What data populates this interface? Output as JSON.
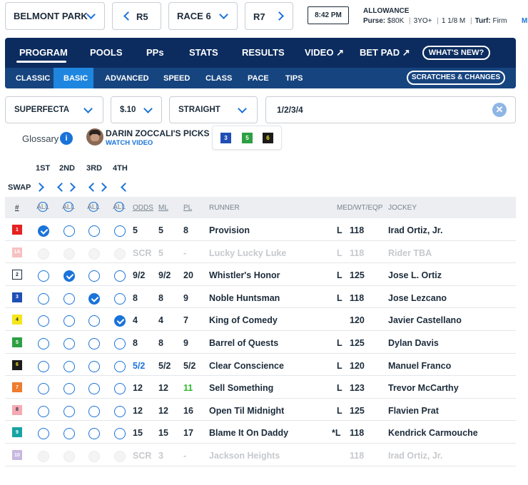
{
  "topbar": {
    "track": "BELMONT PARK",
    "prev_race": "R5",
    "race": "RACE 6",
    "next_race": "R7",
    "post_time": "8:42 PM",
    "race_type": "ALLOWANCE",
    "purse_label": "Purse:",
    "purse": "$80K",
    "age": "3YO+",
    "distance": "1 1/8 M",
    "surface_label": "Turf:",
    "surface": "Firm",
    "overflow": "M"
  },
  "nav": {
    "tabs": [
      "PROGRAM",
      "POOLS",
      "PPs",
      "STATS",
      "RESULTS",
      "VIDEO",
      "BET PAD"
    ],
    "whats_new": "WHAT'S NEW?",
    "subtabs": [
      "CLASSIC",
      "BASIC",
      "ADVANCED",
      "SPEED",
      "CLASS",
      "PACE",
      "TIPS"
    ],
    "scratches": "SCRATCHES & CHANGES"
  },
  "bet": {
    "type": "SUPERFECTA",
    "amount": "$.10",
    "mode": "STRAIGHT",
    "selection": "1/2/3/4"
  },
  "picks": {
    "glossary": "Glossary",
    "title": "DARIN ZOCCALI'S PICKS",
    "watch": "WATCH VIDEO",
    "numbers": [
      "3",
      "5",
      "6"
    ]
  },
  "positions": [
    "1ST",
    "2ND",
    "3RD",
    "4TH"
  ],
  "swap_label": "SWAP",
  "all_label": "ALL",
  "headers": {
    "num": "#",
    "odds": "ODDS",
    "ml": "ML",
    "pl": "PL",
    "runner": "RUNNER",
    "medwt": "MED/WT/EQP",
    "jockey": "JOCKEY"
  },
  "colors": {
    "nav_dark": "#0c2c5f",
    "nav_mid": "#16447f",
    "accent": "#1a73d9",
    "pl_green": "#2eb82e"
  },
  "runners": [
    {
      "pn": "1",
      "bg": "#e52121",
      "fg": "#ffffff",
      "odds": "5",
      "ml": "5",
      "pl": "8",
      "name": "Provision",
      "med": "L",
      "wt": "118",
      "jockey": "Irad Ortiz, Jr.",
      "scr": false,
      "sel": 0
    },
    {
      "pn": "1A",
      "bg": "#f7c1c1",
      "fg": "#ffffff",
      "odds": "SCR",
      "ml": "5",
      "pl": "-",
      "name": "Lucky Lucky Luke",
      "med": "L",
      "wt": "118",
      "jockey": "Rider TBA",
      "scr": true,
      "sel": -1
    },
    {
      "pn": "2",
      "bg": "#ffffff",
      "fg": "#1c2b3a",
      "odds": "9/2",
      "ml": "9/2",
      "pl": "20",
      "name": "Whistler's Honor",
      "med": "L",
      "wt": "125",
      "jockey": "Jose L. Ortiz",
      "scr": false,
      "sel": 1
    },
    {
      "pn": "3",
      "bg": "#1f4fb5",
      "fg": "#ffffff",
      "odds": "8",
      "ml": "8",
      "pl": "9",
      "name": "Noble Huntsman",
      "med": "L",
      "wt": "118",
      "jockey": "Jose Lezcano",
      "scr": false,
      "sel": 2
    },
    {
      "pn": "4",
      "bg": "#f5e61c",
      "fg": "#1c2b3a",
      "odds": "4",
      "ml": "4",
      "pl": "7",
      "name": "King of Comedy",
      "med": "",
      "wt": "120",
      "jockey": "Javier Castellano",
      "scr": false,
      "sel": 3
    },
    {
      "pn": "5",
      "bg": "#2ea043",
      "fg": "#ffffff",
      "odds": "8",
      "ml": "8",
      "pl": "9",
      "name": "Barrel of Quests",
      "med": "L",
      "wt": "125",
      "jockey": "Dylan Davis",
      "scr": false,
      "sel": -1
    },
    {
      "pn": "6",
      "bg": "#1b1b1b",
      "fg": "#f5e61c",
      "odds": "5/2",
      "ml": "5/2",
      "pl": "5/2",
      "name": "Clear Conscience",
      "med": "L",
      "wt": "120",
      "jockey": "Manuel Franco",
      "scr": false,
      "sel": -1,
      "odds_blue": true
    },
    {
      "pn": "7",
      "bg": "#f07b2c",
      "fg": "#ffffff",
      "odds": "12",
      "ml": "12",
      "pl": "11",
      "name": "Sell Something",
      "med": "L",
      "wt": "123",
      "jockey": "Trevor McCarthy",
      "scr": false,
      "sel": -1,
      "pl_green": true
    },
    {
      "pn": "8",
      "bg": "#f5aab3",
      "fg": "#1c2b3a",
      "odds": "12",
      "ml": "12",
      "pl": "16",
      "name": "Open Til Midnight",
      "med": "L",
      "wt": "125",
      "jockey": "Flavien Prat",
      "scr": false,
      "sel": -1
    },
    {
      "pn": "9",
      "bg": "#18a3a3",
      "fg": "#ffffff",
      "odds": "15",
      "ml": "15",
      "pl": "17",
      "name": "Blame It On Daddy",
      "med": "*L",
      "wt": "118",
      "jockey": "Kendrick Carmouche",
      "scr": false,
      "sel": -1
    },
    {
      "pn": "10",
      "bg": "#c7b8e0",
      "fg": "#ffffff",
      "odds": "SCR",
      "ml": "3",
      "pl": "-",
      "name": "Jackson Heights",
      "med": "",
      "wt": "118",
      "jockey": "Irad Ortiz, Jr.",
      "scr": true,
      "sel": -1
    }
  ]
}
